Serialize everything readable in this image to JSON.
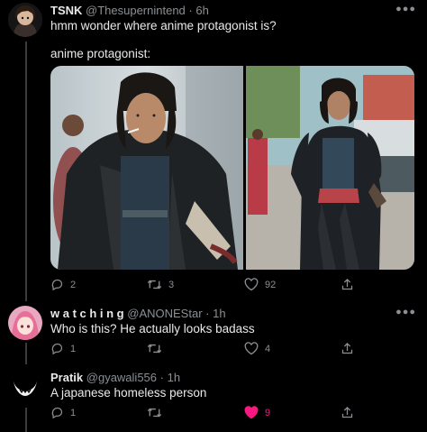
{
  "tweets": [
    {
      "name": "TSNK",
      "handle": "@Thesupernintend",
      "sep": "·",
      "time": "6h",
      "text": "hmm wonder where anime protagonist is?",
      "quote": "anime protagonist:",
      "replies": "2",
      "retweets": "3",
      "likes": "92"
    },
    {
      "name": "w a t c h i n g",
      "handle": "@ANONEStar",
      "sep": "·",
      "time": "1h",
      "text": "Who is this? He actually looks badass",
      "replies": "1",
      "retweets": "",
      "likes": "4"
    },
    {
      "name": "Pratik",
      "handle": "@gyawali556",
      "sep": "·",
      "time": "1h",
      "text": "A japanese homeless person",
      "replies": "1",
      "retweets": "",
      "likes": "9"
    }
  ],
  "icons": {
    "reply": "reply-icon",
    "retweet": "retweet-icon",
    "like": "heart-icon",
    "share": "share-icon",
    "more": "more-icon"
  },
  "colors": {
    "background": "#000000",
    "text": "#e7e9ea",
    "secondary": "#8b8f93",
    "liked": "#f91880",
    "thread_line": "#3a3d40"
  }
}
